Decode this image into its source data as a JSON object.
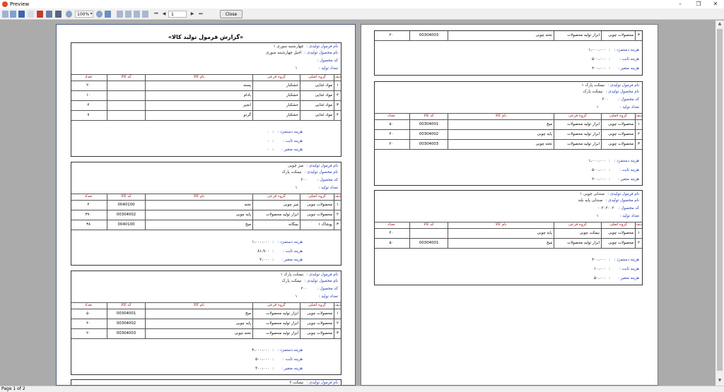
{
  "window": {
    "title": "Preview"
  },
  "toolbar": {
    "zoom": "100%",
    "page": "1",
    "close_label": "Close"
  },
  "status": {
    "page_info": "Page 1 of 2"
  },
  "report": {
    "title": "«گزارش فرمول تولید کالا»",
    "labels": {
      "formula_name": "نام فرمول تولیدی :",
      "product_name": "نام محصول تولیدی :",
      "product_code": "کد محصول :",
      "quantity": "تعداد تولید :",
      "wage": "هزینه دستمزد :",
      "fixed": "هزینه ثابت :",
      "variable": "هزینه متغیر :"
    },
    "columns": [
      "ردیف",
      "گروه اصلی",
      "گروه فرعی",
      "نام کالا",
      "کد کالا",
      "تعداد"
    ]
  },
  "left_page": {
    "records": [
      {
        "formula_name": "چهارشنبه سوری ۱",
        "product_name": "اجیل چهارشنبه سوری",
        "product_code": "",
        "quantity": "۱",
        "rows": [
          [
            "۱",
            "مواد غذایی",
            "خشکبار",
            "پسته",
            "",
            "۲۰"
          ],
          [
            "۲",
            "مواد غذایی",
            "خشکبار",
            "بادام",
            "",
            "۱۰"
          ],
          [
            "۳",
            "مواد غذایی",
            "خشکبار",
            "انجیر",
            "",
            "۴"
          ],
          [
            "۴",
            "مواد غذایی",
            "خشکبار",
            "گردو",
            "",
            "۷"
          ]
        ],
        "wage": "۰",
        "fixed": "۰",
        "variable": "۰"
      },
      {
        "formula_name": "میز چوبی",
        "product_name": "نیمکت پارک",
        "product_code": "۳۰۰",
        "quantity": "۱",
        "rows": [
          [
            "۱",
            "محصولات چوبی",
            "میز چوبی",
            "تخته",
            "0040100",
            "۴"
          ],
          [
            "۲",
            "محصولات چوبی",
            "ابزار تولید محصولات",
            "پایه چوبی",
            "00304002",
            "۳۷۰"
          ],
          [
            "۳",
            "پوشاک ۱",
            "بچگانه",
            "میخ",
            "0040100",
            "۳۸"
          ]
        ],
        "wage": "۱،۰۰۰،۰۰۰",
        "fixed": "۸۱،۹۰۰",
        "variable": "۲،۰۰۰"
      },
      {
        "formula_name": "نیمکت پارک ۱",
        "product_name": "نیمکت پارک",
        "product_code": "۳۰۰",
        "quantity": "۱",
        "rows": [
          [
            "۱",
            "محصولات چوبی",
            "ابزار تولید محصولات",
            "میخ",
            "00304001",
            "۵۰"
          ],
          [
            "۲",
            "محصولات چوبی",
            "ابزار تولید محصولات",
            "پایه چوبی",
            "00304002",
            "۴۰"
          ],
          [
            "۳",
            "محصولات چوبی",
            "ابزار تولید محصولات",
            "تخته چوبی",
            "00304003",
            "۲۰"
          ]
        ],
        "wage": "۲،۰۰۰،۰۰۰",
        "fixed": "۵۰۰،۰۰۰",
        "variable": "۳۰۰،۰۰۰"
      }
    ],
    "next_formula_name": "نیمکت ۲"
  },
  "right_page": {
    "carry_row": [
      "۳",
      "محصولات چوبی",
      "ابزار تولید محصولات",
      "تخته چوبی",
      "00304003",
      "۲۰"
    ],
    "carry_costs": {
      "wage": "۱،۰۰۰،۰۰۰",
      "fixed": "۵۰۰،۰۰۰",
      "variable": "۲۰۰،۰۰۰"
    },
    "records": [
      {
        "formula_name": "نیمکت پارک ۱",
        "product_name": "نیمکت پارک",
        "product_code": "۳۰۰",
        "quantity": "۱",
        "rows": [
          [
            "۱",
            "محصولات چوبی",
            "ابزار تولید محصولات",
            "میخ",
            "00304001",
            "۵۰"
          ],
          [
            "۲",
            "محصولات چوبی",
            "ابزار تولید محصولات",
            "پایه چوبی",
            "00304002",
            "۴۰"
          ],
          [
            "۳",
            "محصولات چوبی",
            "ابزار تولید محصولات",
            "تخته چوبی",
            "00304003",
            "۲۰"
          ]
        ],
        "wage": "۱،۰۰۰،۰۰۰",
        "fixed": "۵۰۰،۰۰۰",
        "variable": "۲۰۰،۰۰۰"
      },
      {
        "formula_name": "صندلی چوبی ۱",
        "product_name": "صندلی پایه بلند",
        "product_code": "۰۰۳۰۳۰۰۲",
        "quantity": "۱",
        "rows": [
          [
            "۱",
            "محصولات چوبی",
            "نیمکت چوبی",
            "پایه چوبی",
            "",
            "۴۰"
          ],
          [
            "۲",
            "محصولات چوبی",
            "ابزار تولید محصولات",
            "میخ",
            "00304001",
            "۵۰"
          ]
        ],
        "wage": "۲۰۰،۰۰۰",
        "fixed": "۱۰،۰۰۰",
        "variable": "۵۰،۰۰۰"
      }
    ]
  }
}
